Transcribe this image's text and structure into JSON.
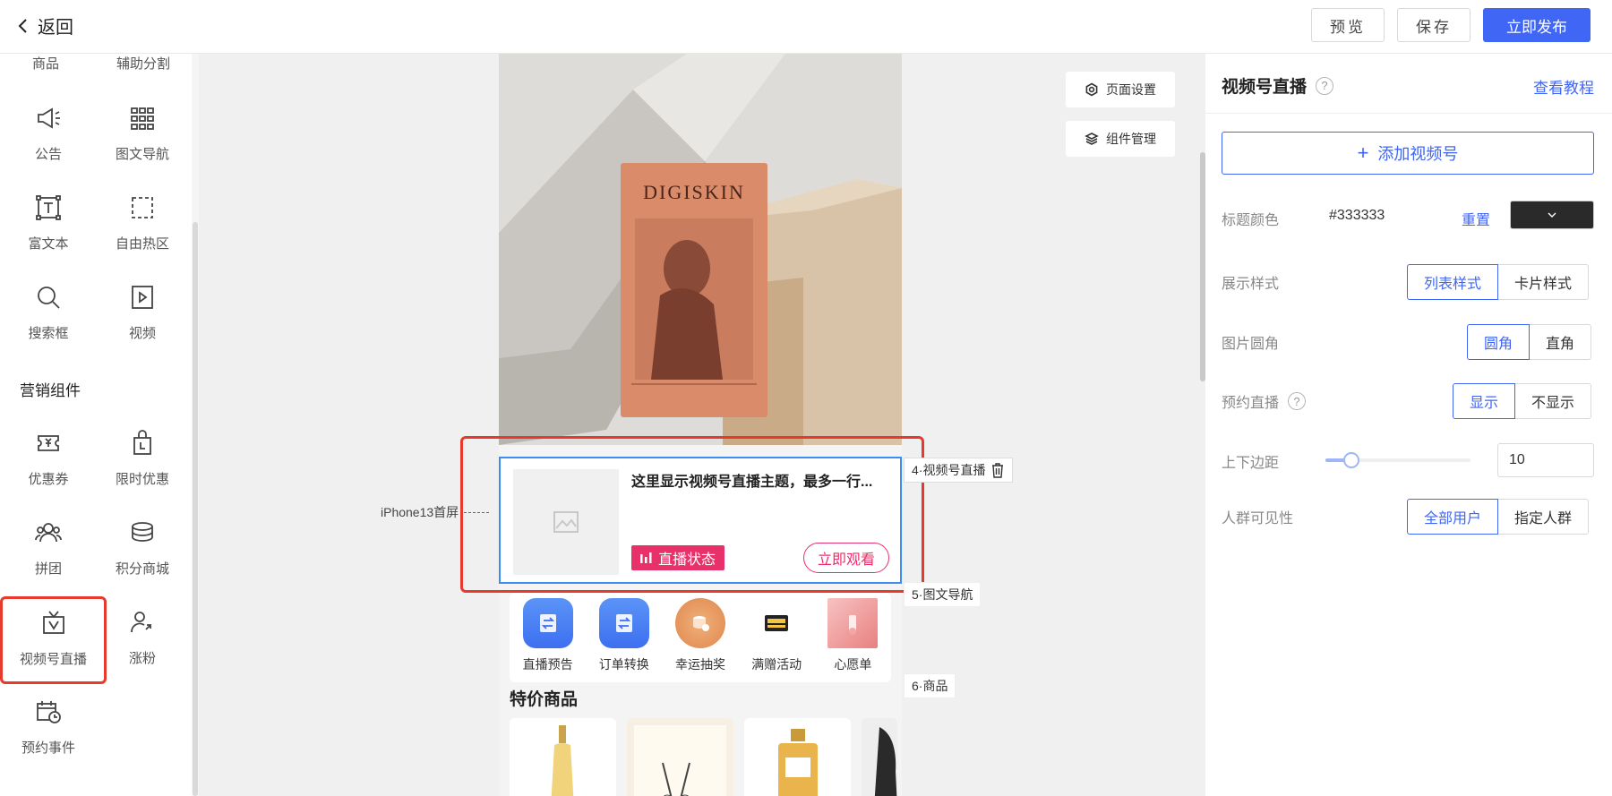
{
  "topbar": {
    "back_label": "返回",
    "preview": "预览",
    "save": "保存",
    "publish": "立即发布"
  },
  "sidebar": {
    "top_cut": [
      "商品",
      "辅助分割"
    ],
    "basic_items": [
      {
        "label": "公告",
        "icon": "megaphone-icon"
      },
      {
        "label": "图文导航",
        "icon": "grid-icon"
      },
      {
        "label": "富文本",
        "icon": "text-box-icon"
      },
      {
        "label": "自由热区",
        "icon": "dashed-square-icon"
      },
      {
        "label": "搜索框",
        "icon": "search-icon"
      },
      {
        "label": "视频",
        "icon": "video-play-icon"
      }
    ],
    "marketing_title": "营销组件",
    "marketing_items": [
      {
        "label": "优惠券",
        "icon": "coupon-icon"
      },
      {
        "label": "限时优惠",
        "icon": "shopping-bag-icon"
      },
      {
        "label": "拼团",
        "icon": "group-icon"
      },
      {
        "label": "积分商城",
        "icon": "coins-icon"
      },
      {
        "label": "视频号直播",
        "icon": "tv-live-icon"
      },
      {
        "label": "涨粉",
        "icon": "user-growth-icon"
      },
      {
        "label": "预约事件",
        "icon": "calendar-clock-icon"
      }
    ]
  },
  "canvas": {
    "page_settings": "页面设置",
    "component_manage": "组件管理",
    "iphone_label": "iPhone13首屏",
    "hero_brand": "DIGISKIN",
    "live_card": {
      "title": "这里显示视频号直播主题，最多一行...",
      "status": "直播状态",
      "watch": "立即观看"
    },
    "tags": {
      "live": "4·视频号直播",
      "nav": "5·图文导航",
      "goods": "6·商品"
    },
    "nav_items": [
      {
        "label": "直播预告",
        "color": "#3d7ef5"
      },
      {
        "label": "订单转换",
        "color": "#3d7ef5"
      },
      {
        "label": "幸运抽奖",
        "color": "#e8955a"
      },
      {
        "label": "满赠活动",
        "color": "#ffffff"
      },
      {
        "label": "心愿单",
        "color": "#f0a0a0"
      }
    ],
    "section_title": "特价商品"
  },
  "panel": {
    "title": "视频号直播",
    "tutorial": "查看教程",
    "add_channel": "添加视频号",
    "title_color_label": "标题颜色",
    "title_color_value": "#333333",
    "reset": "重置",
    "display_style_label": "展示样式",
    "display_style_options": [
      "列表样式",
      "卡片样式"
    ],
    "display_style_selected": 0,
    "corner_label": "图片圆角",
    "corner_options": [
      "圆角",
      "直角"
    ],
    "corner_selected": 0,
    "reserve_label": "预约直播",
    "reserve_options": [
      "显示",
      "不显示"
    ],
    "reserve_selected": 0,
    "margin_label": "上下边距",
    "margin_value": "10",
    "margin_fraction": 0.18,
    "audience_label": "人群可见性",
    "audience_options": [
      "全部用户",
      "指定人群"
    ],
    "audience_selected": 0
  },
  "colors": {
    "accent": "#4066f5",
    "live_pink": "#e8306a",
    "highlight_red": "#e83a2c",
    "selection_blue": "#3d8cf0"
  }
}
